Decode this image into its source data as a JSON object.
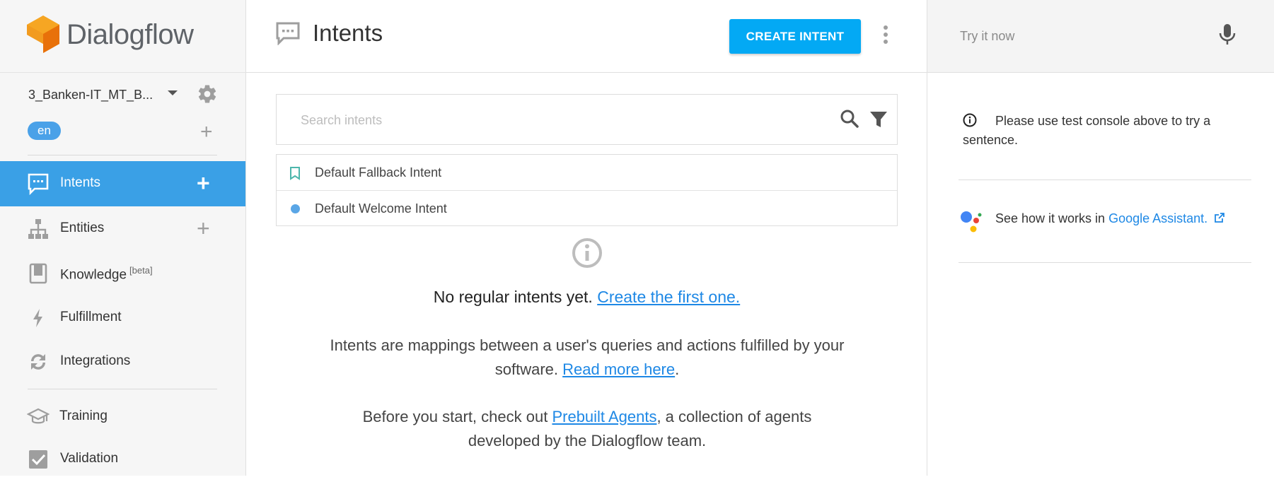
{
  "app": {
    "name": "Dialogflow"
  },
  "sidebar": {
    "agent_name": "3_Banken-IT_MT_B...",
    "language": "en",
    "nav": [
      {
        "label": "Intents",
        "beta": ""
      },
      {
        "label": "Entities",
        "beta": ""
      },
      {
        "label": "Knowledge",
        "beta": "[beta]"
      },
      {
        "label": "Fulfillment",
        "beta": ""
      },
      {
        "label": "Integrations",
        "beta": ""
      },
      {
        "label": "Training",
        "beta": ""
      },
      {
        "label": "Validation",
        "beta": ""
      }
    ],
    "active_item": "Intents"
  },
  "header": {
    "title": "Intents",
    "create_button": "CREATE INTENT"
  },
  "search": {
    "placeholder": "Search intents"
  },
  "intents": [
    {
      "name": "Default Fallback Intent",
      "icon": "bookmark-icon"
    },
    {
      "name": "Default Welcome Intent",
      "icon": "dot-icon"
    }
  ],
  "empty_state": {
    "line_text": "No regular intents yet.",
    "line_link": "Create the first one.",
    "desc1_text": "Intents are mappings between a user's queries and actions fulfilled by your software.",
    "desc1_link": "Read more here",
    "desc1_end": ".",
    "desc2_text": "Before you start, check out",
    "desc2_link": "Prebuilt Agents",
    "desc2_end": ", a collection of agents developed by the Dialogflow team."
  },
  "try_panel": {
    "placeholder": "Try it now",
    "info_note": "Please use test console above to try a sentence.",
    "assistant_text": "See how it works in",
    "assistant_link": "Google Assistant."
  },
  "colors": {
    "accent": "#03a9f4",
    "active_nav": "#3aa0e6",
    "link": "#1e88e5",
    "logo_orange": "#ef8a0c"
  }
}
